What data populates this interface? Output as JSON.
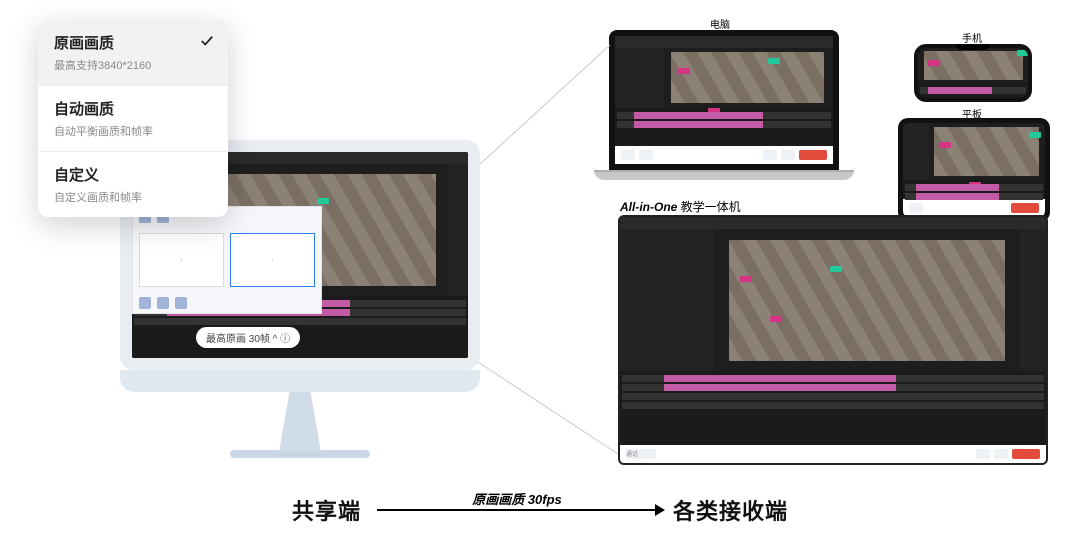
{
  "quality_popover": {
    "items": [
      {
        "title": "原画画质",
        "sub": "最高支持3840*2160",
        "checked": true
      },
      {
        "title": "自动画质",
        "sub": "自动平衡画质和帧率",
        "checked": false
      },
      {
        "title": "自定义",
        "sub": "自定义画质和帧率",
        "checked": false
      }
    ]
  },
  "imac": {
    "fps_chip": "最高原画 30帧 ^ ⓘ",
    "share_picker": {
      "opt1": "·",
      "opt2": "·"
    }
  },
  "devices": {
    "laptop_label": "电脑",
    "phone_label": "手机",
    "tablet_label": "平板",
    "allinone_label_em": "All-in-One",
    "allinone_label_rest": " 教学一体机"
  },
  "bottom": {
    "left": "共享端",
    "caption": "原画画质 30fps",
    "right": "各类接收端"
  },
  "editor": {
    "bottom_buttons": {
      "call": "通话"
    }
  }
}
